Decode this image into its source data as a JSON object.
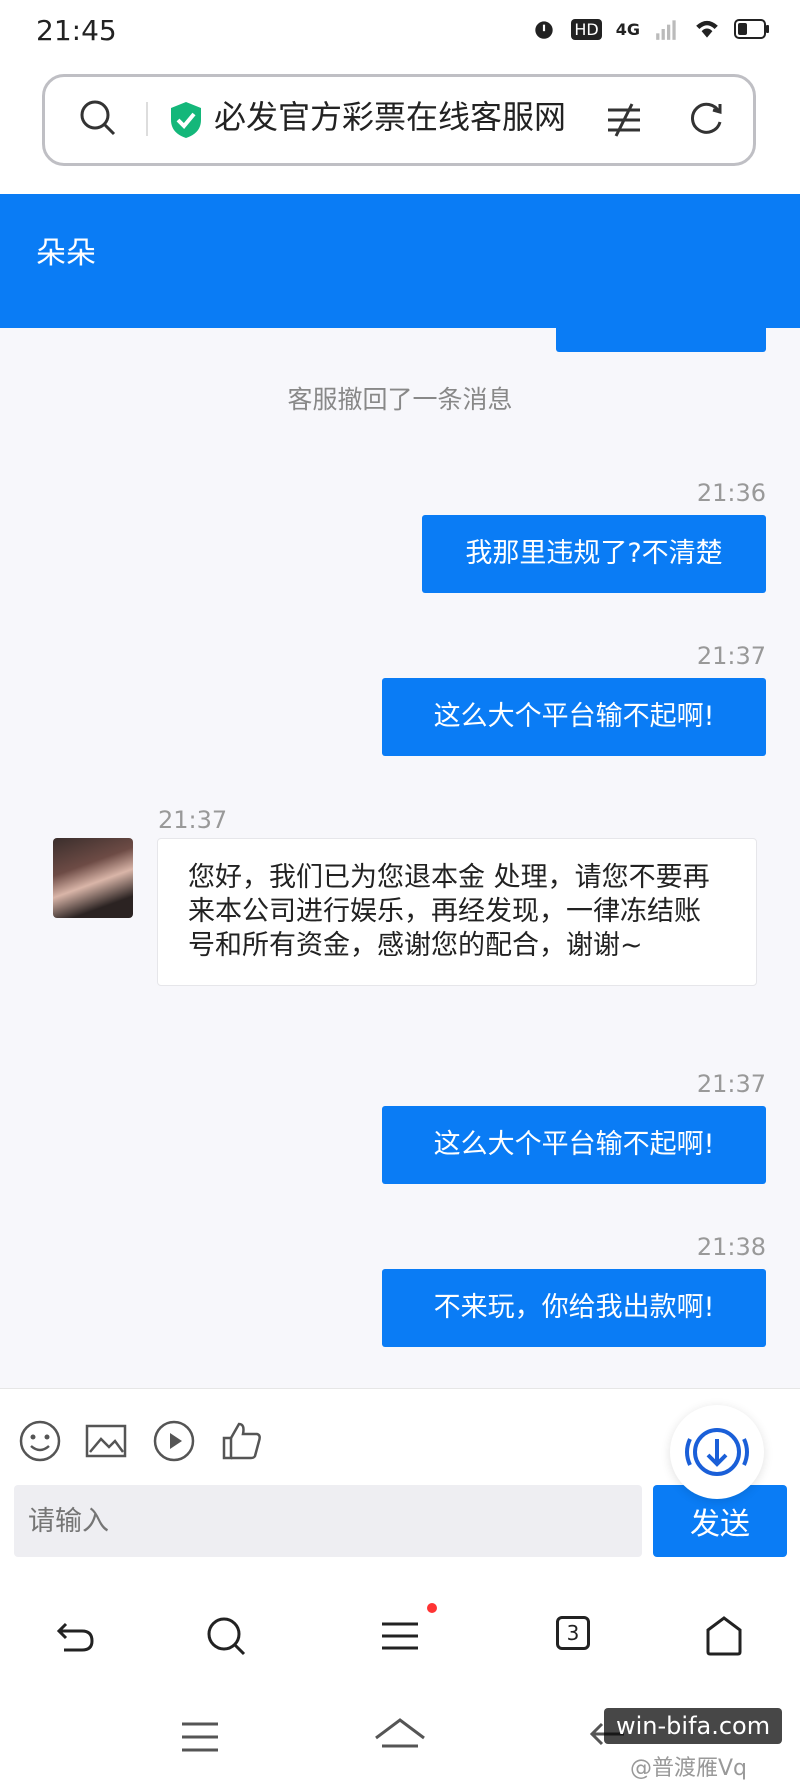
{
  "status": {
    "time": "21:45",
    "network": "4G",
    "hd": "HD"
  },
  "address_bar": {
    "url_title": "必发官方彩票在线客服网"
  },
  "header": {
    "title": "朵朵"
  },
  "chat": {
    "recall_notice": "客服撤回了一条消息",
    "messages": [
      {
        "time": "21:36",
        "direction": "out",
        "text": "我那里违规了?不清楚"
      },
      {
        "time": "21:37",
        "direction": "out",
        "text": "这么大个平台输不起啊!"
      },
      {
        "time": "21:37",
        "direction": "in",
        "text": "您好，我们已为您退本金 处理，请您不要再来本公司进行娱乐，再经发现，一律冻结账号和所有资金，感谢您的配合，谢谢~"
      },
      {
        "time": "21:37",
        "direction": "out",
        "text": "这么大个平台输不起啊!"
      },
      {
        "time": "21:38",
        "direction": "out",
        "text": "不来玩，你给我出款啊!"
      }
    ]
  },
  "input": {
    "placeholder": "请输入",
    "send_label": "发送"
  },
  "browser_nav": {
    "tab_count": "3"
  },
  "watermark": {
    "site": "win-bifa.com",
    "user": "@普渡雁Vq"
  },
  "colors": {
    "accent": "#0a7cf5",
    "background": "#f7f7fb"
  }
}
